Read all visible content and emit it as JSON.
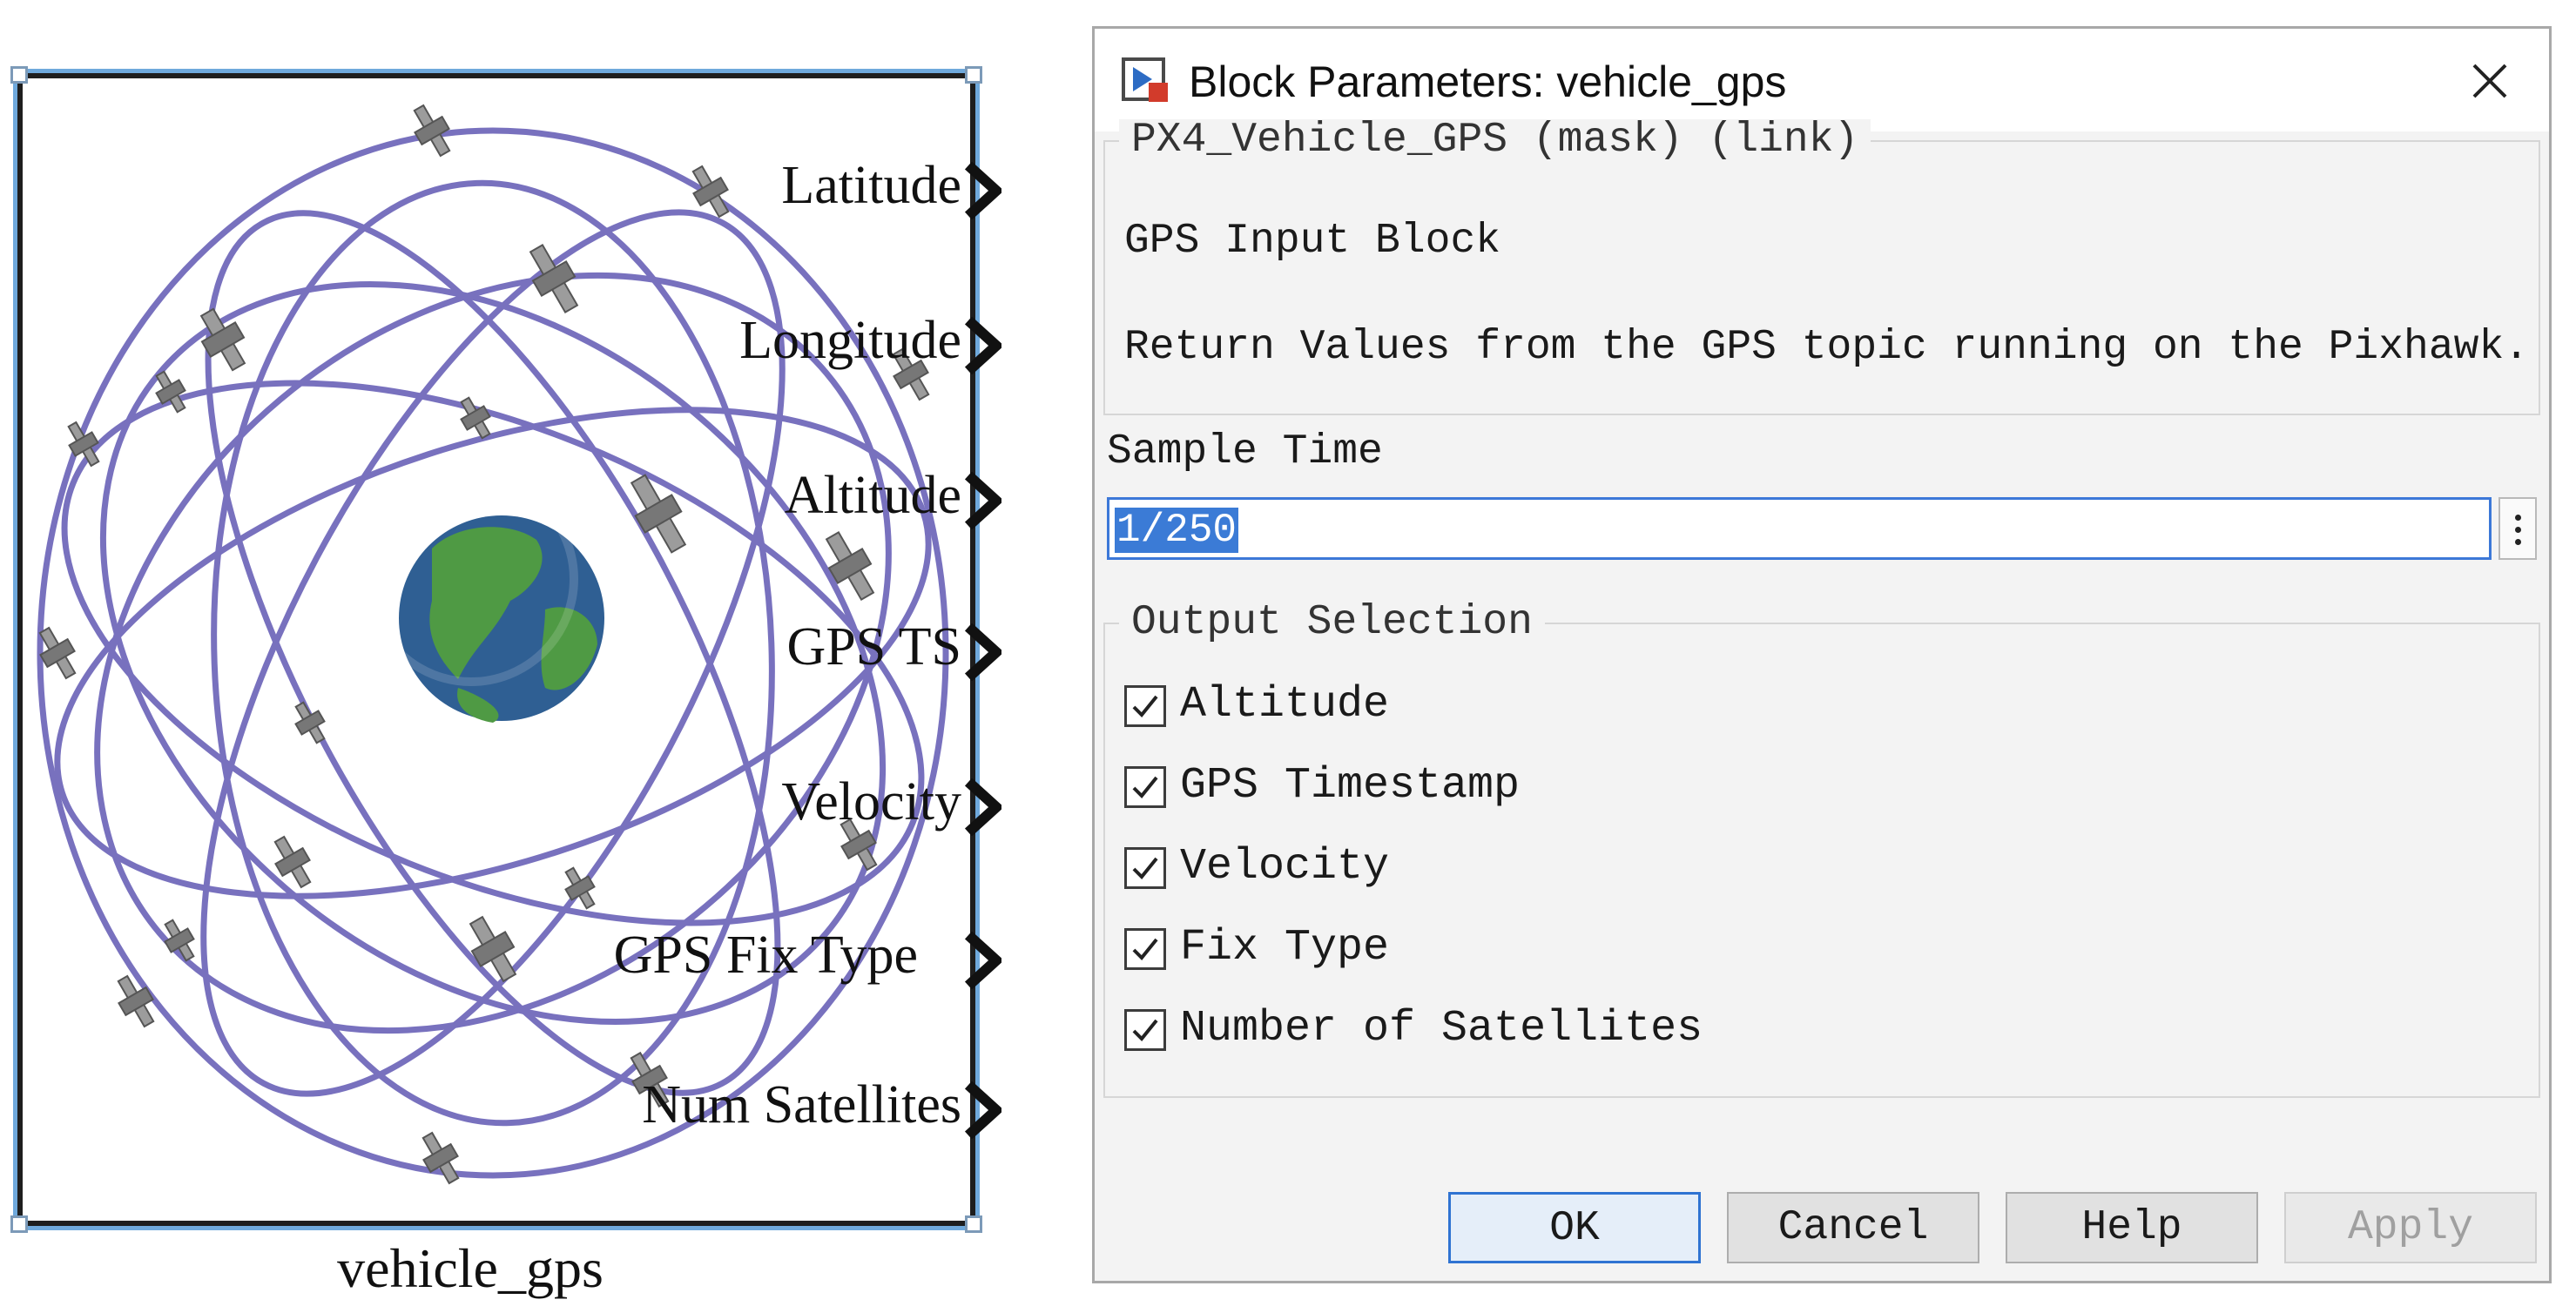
{
  "block": {
    "name": "vehicle_gps",
    "ports": [
      "Latitude",
      "Longitude",
      "Altitude",
      "GPS TS",
      "Velocity",
      "GPS Fix Type",
      "Num Satellites"
    ]
  },
  "dialog": {
    "title": "Block Parameters: vehicle_gps",
    "mask_group": "PX4_Vehicle_GPS (mask) (link)",
    "description_title": "GPS Input Block",
    "description_text": "Return Values from the GPS topic running on the Pixhawk.",
    "sample_time_label": "Sample Time",
    "sample_time_value": "1/250",
    "output_selection_label": "Output Selection",
    "outputs": [
      {
        "label": "Altitude",
        "checked": true
      },
      {
        "label": "GPS Timestamp",
        "checked": true
      },
      {
        "label": "Velocity",
        "checked": true
      },
      {
        "label": "Fix Type",
        "checked": true
      },
      {
        "label": "Number of Satellites",
        "checked": true
      }
    ],
    "buttons": {
      "ok": "OK",
      "cancel": "Cancel",
      "help": "Help",
      "apply": "Apply"
    }
  },
  "colors": {
    "orbit": "#6a62b8",
    "selection_border": "#6fa9dc",
    "ok_focus": "#2f73d2",
    "input_highlight": "#3b7bd6"
  },
  "icons": [
    "simulink-block-icon",
    "close-icon",
    "more-options-icon",
    "checkmark-icon",
    "port-arrow-icon",
    "earth-icon",
    "satellite-icon"
  ]
}
